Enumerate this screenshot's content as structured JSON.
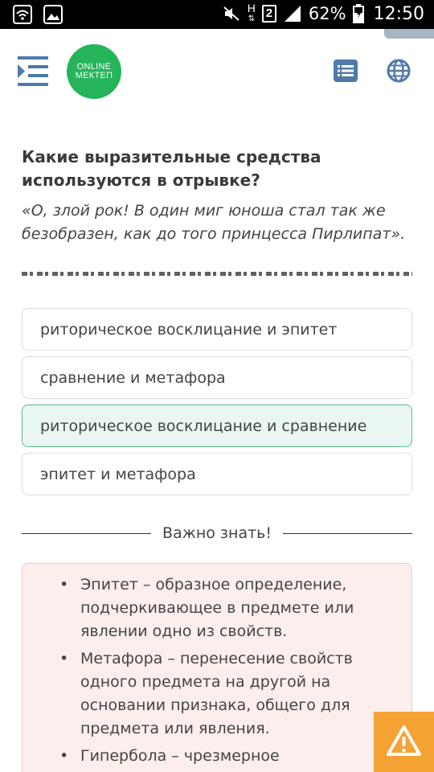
{
  "status_bar": {
    "battery": "62%",
    "time": "12:50",
    "sim_slot": "2",
    "network": "H"
  },
  "header": {
    "logo_line1": "ONLINE",
    "logo_line2": "МЕКТЕП",
    "icons": [
      "menu-collapse-icon",
      "list-icon",
      "globe-icon"
    ]
  },
  "question": {
    "text": "Какие выразительные средства используются в отрывке?",
    "quote": "«О, злой рок! В один миг юноша стал так же безобразен, как до того принцесса Пирлипат»."
  },
  "options": [
    {
      "label": "риторическое восклицание и эпитет",
      "selected": false
    },
    {
      "label": "сравнение и метафора",
      "selected": false
    },
    {
      "label": "риторическое восклицание и сравнение",
      "selected": true
    },
    {
      "label": "эпитет и метафора",
      "selected": false
    }
  ],
  "important": {
    "title": "Важно знать!",
    "items": [
      "Эпитет – образное определение, подчеркивающее в предмете или явлении одно из свойств.",
      "Метафора – перенесение свойств одного предмета на другой на основании признака, общего для предмета или явления.",
      "Гипербола – чрезмерное"
    ]
  },
  "colors": {
    "brand_green": "#25b45a",
    "selected_bg": "#eaf7f1",
    "selected_border": "#5fb98a",
    "info_bg": "#fdeeee",
    "warning_orange": "#f5a234",
    "icon_blue": "#4f7aa8"
  }
}
